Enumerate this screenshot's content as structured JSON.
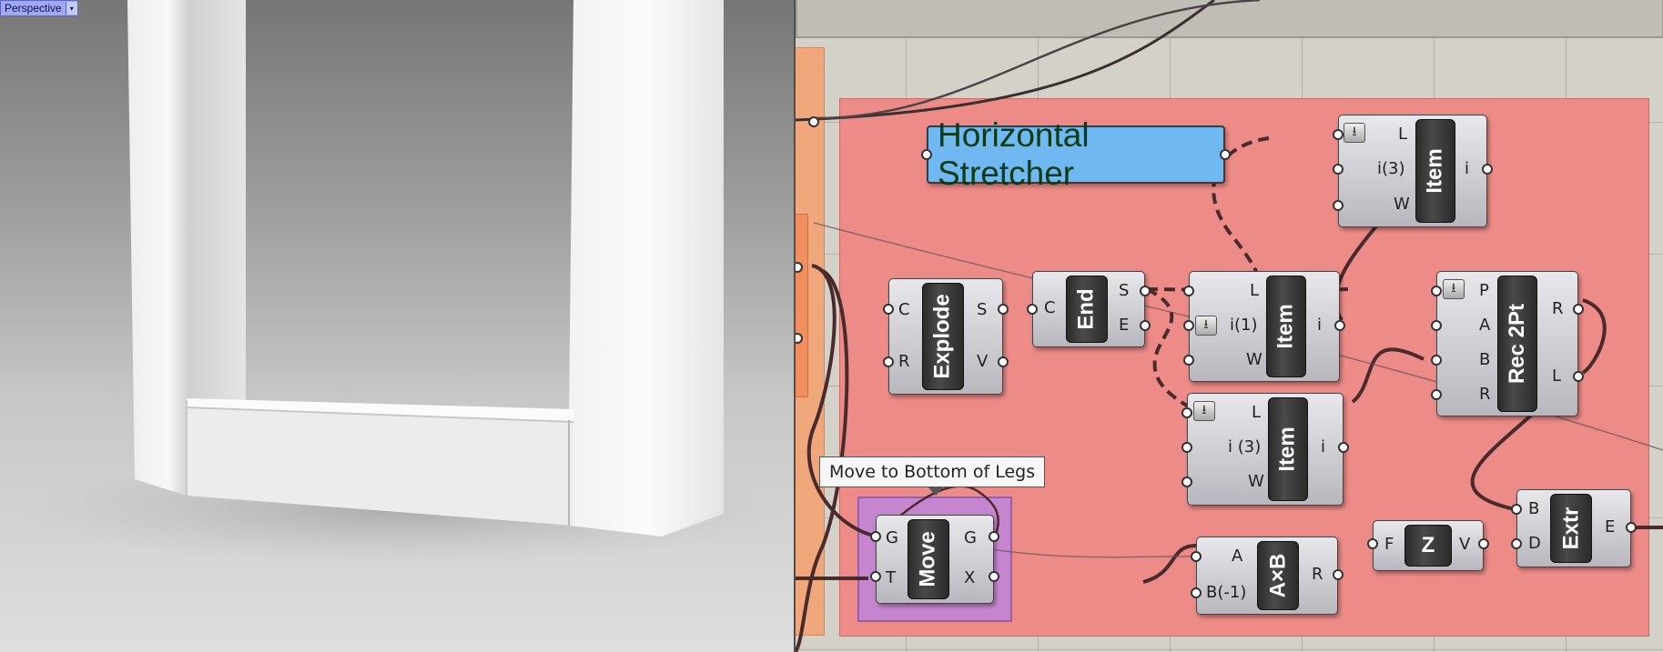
{
  "viewport": {
    "label": "Perspective",
    "dropdown_glyph": "▾"
  },
  "canvas": {
    "group_title": "Horizontal Stretcher",
    "tooltip": "Move to Bottom of Legs",
    "components": {
      "item_top": {
        "label": "Item",
        "inputs": [
          "L",
          "i(3)",
          "W"
        ],
        "outputs": [
          "i"
        ]
      },
      "explode": {
        "label": "Explode",
        "inputs": [
          "C",
          "R"
        ],
        "outputs": [
          "S",
          "V"
        ]
      },
      "end": {
        "label": "End",
        "inputs": [
          "C"
        ],
        "outputs": [
          "S",
          "E"
        ]
      },
      "item_mid": {
        "label": "Item",
        "inputs": [
          "L",
          "i(1)",
          "W"
        ],
        "outputs": [
          "i"
        ]
      },
      "rec2pt": {
        "label": "Rec 2Pt",
        "inputs": [
          "P",
          "A",
          "B",
          "R"
        ],
        "outputs": [
          "R",
          "L"
        ]
      },
      "item_low": {
        "label": "Item",
        "inputs": [
          "L",
          "i (3)",
          "W"
        ],
        "outputs": [
          "i"
        ]
      },
      "move": {
        "label": "Move",
        "inputs": [
          "G",
          "T"
        ],
        "outputs": [
          "G",
          "X"
        ]
      },
      "multiply": {
        "label": "A×B",
        "inputs": [
          "A",
          "B(-1)"
        ],
        "outputs": [
          "R"
        ]
      },
      "z": {
        "label": "Z",
        "inputs": [
          "F"
        ],
        "outputs": [
          "V"
        ]
      },
      "extr": {
        "label": "Extr",
        "inputs": [
          "B",
          "D"
        ],
        "outputs": [
          "E"
        ]
      }
    },
    "flatten_glyph": "⭳"
  },
  "colors": {
    "red_group": "#ec8b87",
    "purple_group": "#c586cf",
    "orange_group": "#efa77b",
    "panel": "#6fb8f2",
    "wire": "#4a2b2b"
  }
}
